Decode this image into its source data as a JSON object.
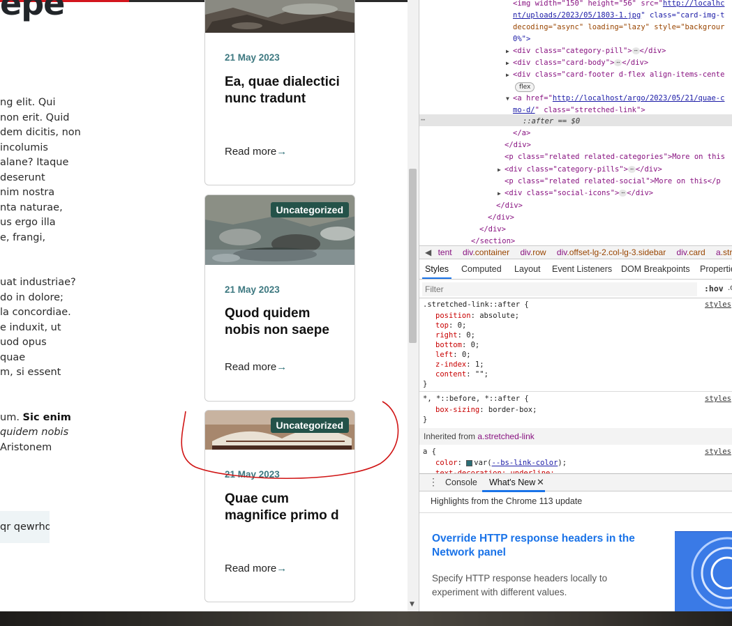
{
  "page": {
    "title_fragment": "epe",
    "article_lines": [
      {
        "text": "ng elit. Qui"
      },
      {
        "text": "non erit. Quid"
      },
      {
        "text": "dem dicitis, non"
      },
      {
        "text": "incolumis"
      },
      {
        "text": "alane? Itaque"
      },
      {
        "text": "deserunt"
      },
      {
        "text": "nim nostra"
      },
      {
        "text": "nta naturae,"
      },
      {
        "text": "us ergo illa"
      },
      {
        "text": "e, frangi,"
      },
      {
        "text": ""
      },
      {
        "text": ""
      },
      {
        "text": "uat industriae?"
      },
      {
        "text": "do in dolore;"
      },
      {
        "text": "la concordiae."
      },
      {
        "text": "e induxit, ut"
      },
      {
        "text": "uod opus"
      },
      {
        "text": " quae"
      },
      {
        "text": "m, si essent"
      }
    ],
    "article_bold_line": {
      "pre": "um. ",
      "bold": "Sic enim"
    },
    "article_italic_line": "quidem nobis",
    "article_last_line": "Aristonem",
    "tag_chip": "qr qewrhq",
    "cards": [
      {
        "date": "21 May 2023",
        "title": "Ea, quae dialectici nunc tradunt",
        "read_more": "Read more",
        "category": ""
      },
      {
        "date": "21 May 2023",
        "title": "Quod quidem nobis non saepe",
        "read_more": "Read more",
        "category": "Uncategorized"
      },
      {
        "date": "21 May 2023",
        "title": "Quae cum magnifice primo d",
        "read_more": "Read more",
        "category": "Uncategorized"
      }
    ],
    "annotation_color": "#d01414"
  },
  "devtools": {
    "dom": {
      "img_line1_a": "<img width=\"150\" height=\"56\" src=\"",
      "img_src_part1": "http://localhc",
      "img_src_part2": "nt/uploads/2023/05/1803-1.jpg",
      "img_line2_b": "\" class=\"card-img-t",
      "img_line3": "decoding=\"async\" loading=\"lazy\" style=\"backgrour",
      "img_line4": "0%\">",
      "category_pill": "<div class=\"category-pill\">",
      "card_body": "<div class=\"card-body\">",
      "card_footer": "<div class=\"card-footer d-flex align-items-cente",
      "flex_badge": "flex",
      "a_href_pre": "<a href=\"",
      "a_href_url1": "http://localhost/argo/2023/05/21/quae-c",
      "a_href_url2": "mo-d/",
      "a_href_post": "\" class=\"stretched-link\">",
      "after_pseudo": "::after == $0",
      "close_a": "</a>",
      "close_div": "</div>",
      "related_categories": "<p class=\"related related-categories\">More on this",
      "category_pills": "<div class=\"category-pills\">",
      "related_social": "<p class=\"related related-social\">More on this</p",
      "social_icons": "<div class=\"social-icons\">",
      "close_section": "</section>",
      "ellipsis": "⋯",
      "end_div": "</div>"
    },
    "breadcrumbs": [
      {
        "tag": "tent",
        "cls": ""
      },
      {
        "tag": "div",
        "cls": ".container"
      },
      {
        "tag": "div",
        "cls": ".row"
      },
      {
        "tag": "div",
        "cls": ".offset-lg-2.col-lg-3.sidebar"
      },
      {
        "tag": "div",
        "cls": ".card"
      },
      {
        "tag": "a",
        "cls": ".stre"
      }
    ],
    "style_tabs": [
      "Styles",
      "Computed",
      "Layout",
      "Event Listeners",
      "DOM Breakpoints",
      "Properties"
    ],
    "filter_placeholder": "Filter",
    "hov": ":hov",
    "cls": ".c",
    "rules": {
      "r1_selector": ".stretched-link::after {",
      "r1_src": "styles",
      "r1_props": [
        {
          "name": "position",
          "value": "absolute;"
        },
        {
          "name": "top",
          "value": "0;"
        },
        {
          "name": "right",
          "value": "0;"
        },
        {
          "name": "bottom",
          "value": "0;"
        },
        {
          "name": "left",
          "value": "0;"
        },
        {
          "name": "z-index",
          "value": "1;"
        },
        {
          "name": "content",
          "value": "\"\";"
        }
      ],
      "r2_selector": "*, *::before, *::after {",
      "r2_src": "styles",
      "r2_prop_name": "box-sizing",
      "r2_prop_value": "border-box;",
      "inherited_label": "Inherited from ",
      "inherited_from": "a.stretched-link",
      "r3_selector": "a {",
      "r3_src": "styles",
      "r3_prop_name": "color",
      "r3_prop_value": "var(",
      "r3_var": "--bs-link-color",
      "r3_prop_value_end": ");",
      "r3_cut": "text-decoration: underline;",
      "close_brace": "}"
    },
    "drawer": {
      "tabs": [
        "Console",
        "What's New"
      ],
      "close": "✕",
      "highlights": "Highlights from the Chrome 113 update",
      "headline": "Override HTTP response headers in the Network panel",
      "description": "Specify HTTP response headers locally to experiment with different values."
    }
  }
}
